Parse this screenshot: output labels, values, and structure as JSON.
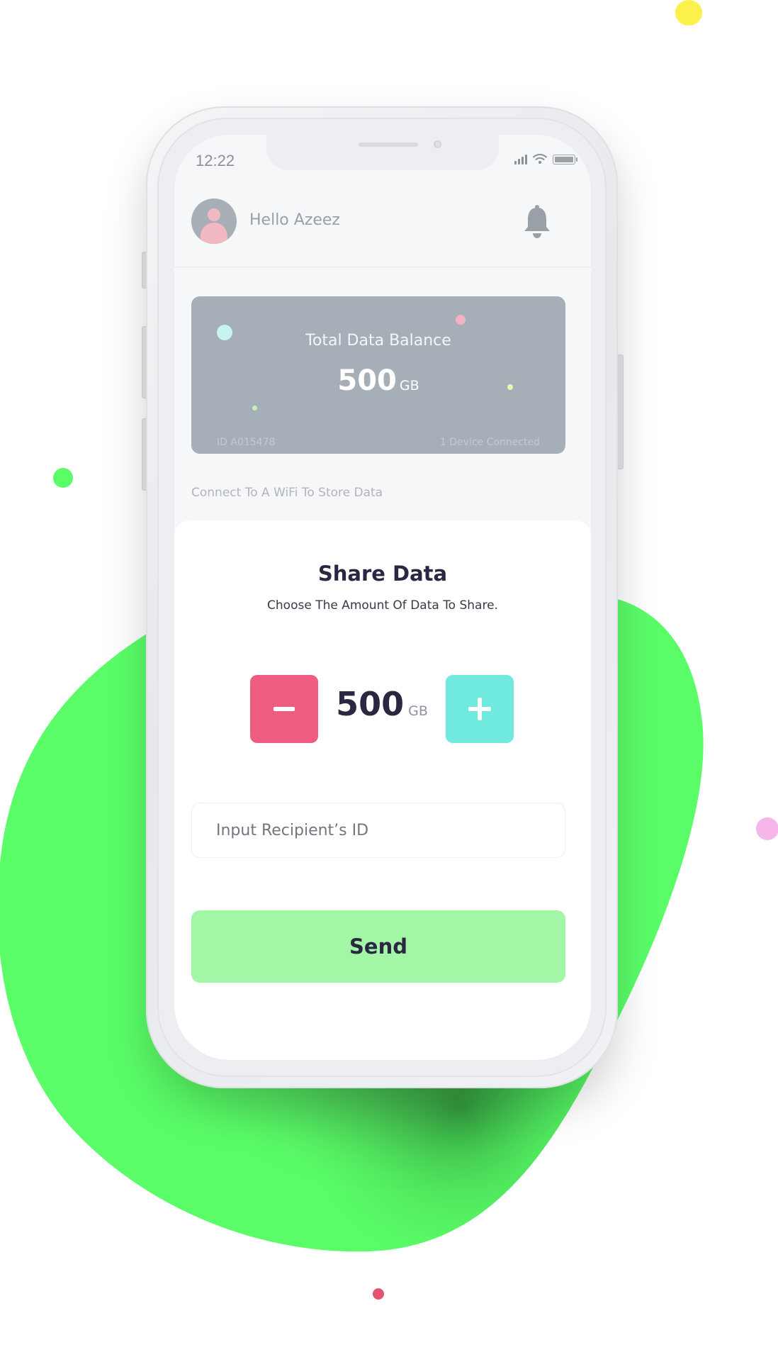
{
  "status_bar": {
    "time": "12:22"
  },
  "header": {
    "greeting": "Hello Azeez"
  },
  "balance_card": {
    "label": "Total Data Balance",
    "value": "500",
    "unit": "GB",
    "account_id": "ID A015478",
    "devices": "1 Device Connected"
  },
  "wifi_note": "Connect To A WiFi To Store Data",
  "share": {
    "title": "Share Data",
    "subtitle": "Choose The Amount Of Data To Share.",
    "amount": "500",
    "unit": "GB",
    "recipient_placeholder": "Input Recipient’s ID",
    "send_label": "Send"
  },
  "icons": {
    "avatar": "user-avatar",
    "bell": "bell-icon",
    "minus": "minus-icon",
    "plus": "plus-icon",
    "signal": "signal-icon",
    "wifi": "wifi-icon",
    "battery": "battery-icon"
  },
  "colors": {
    "background_blob": "#5afd68",
    "card": "#a6afb8",
    "minus_button": "#ef5c81",
    "plus_button": "#70e9de",
    "send_button": "#a2f6a6",
    "title_text": "#2a2743",
    "dot_yellow": "#fcf14a",
    "dot_pink": "#f7b6ea",
    "dot_red": "#e2536f"
  }
}
